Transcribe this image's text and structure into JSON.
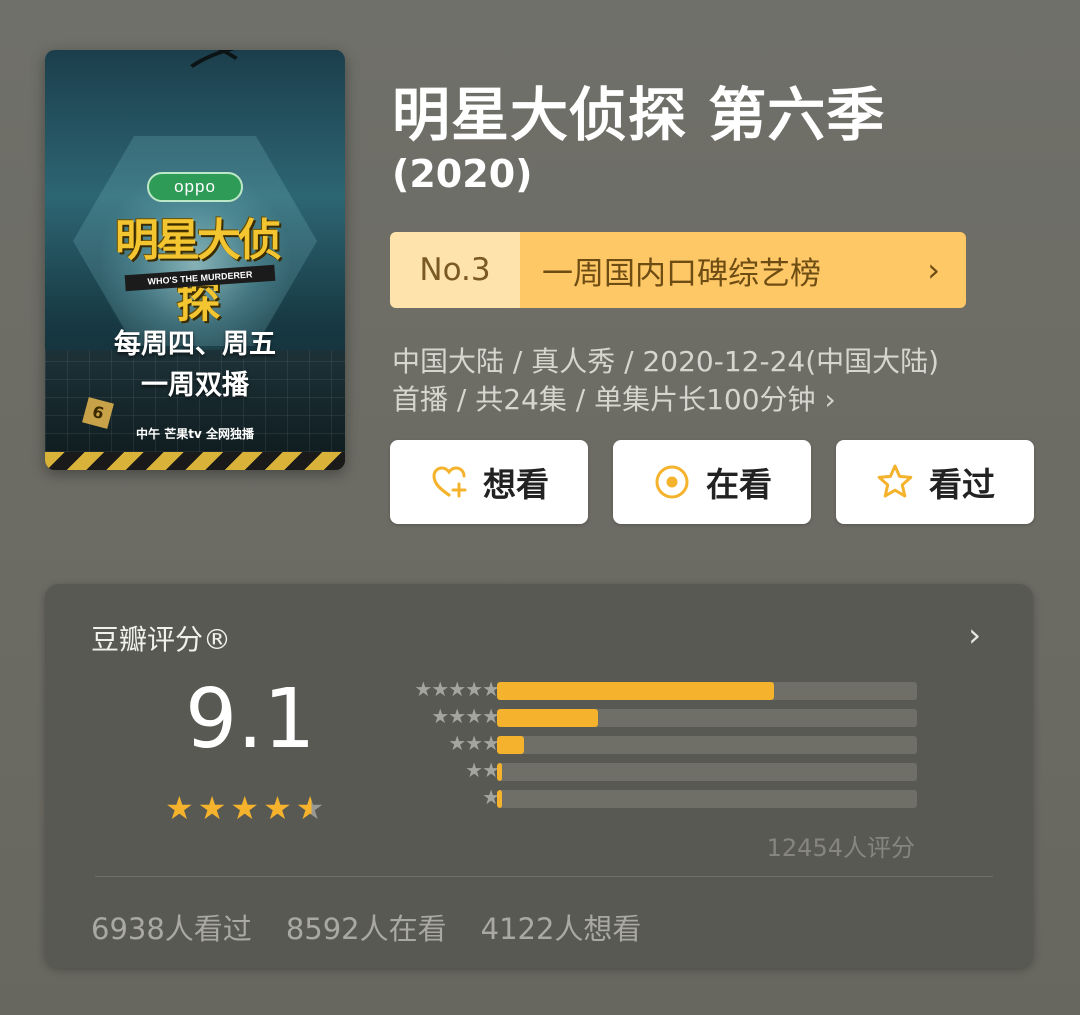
{
  "poster": {
    "oppo": "oppo",
    "logo": "明星大侦探",
    "eng": "WHO'S THE MURDERER",
    "promo_line1": "每周四、周五",
    "promo_line2": "一周双播",
    "season_badge": "6",
    "broadcast": "中午 芒果tv 全网独播"
  },
  "title": "明星大侦探 第六季",
  "year": "(2020)",
  "ranking": {
    "number": "No.3",
    "label": "一周国内口碑综艺榜",
    "chevron": "›"
  },
  "meta": {
    "line1": "中国大陆 / 真人秀 / 2020-12-24(中国大陆)",
    "line2": "首播 / 共24集 / 单集片长100分钟 ›"
  },
  "actions": [
    {
      "label": "想看",
      "icon": "heart-plus-icon"
    },
    {
      "label": "在看",
      "icon": "target-icon"
    },
    {
      "label": "看过",
      "icon": "star-outline-icon"
    }
  ],
  "rating": {
    "header": "豆瓣评分®",
    "score": "9.1",
    "star_value": 4.5,
    "distribution": [
      {
        "stars": "★★★★★",
        "fraction": 0.66
      },
      {
        "stars": "★★★★",
        "fraction": 0.24
      },
      {
        "stars": "★★★",
        "fraction": 0.065
      },
      {
        "stars": "★★",
        "fraction": 0.012
      },
      {
        "stars": "★",
        "fraction": 0.012
      }
    ],
    "rating_count": "12454人评分",
    "watched": "6938人看过",
    "watching": "8592人在看",
    "want": "4122人想看"
  },
  "colors": {
    "accent": "#f5b32d",
    "rank_light": "#ffe3ac",
    "rank_dark": "#ffc866"
  }
}
